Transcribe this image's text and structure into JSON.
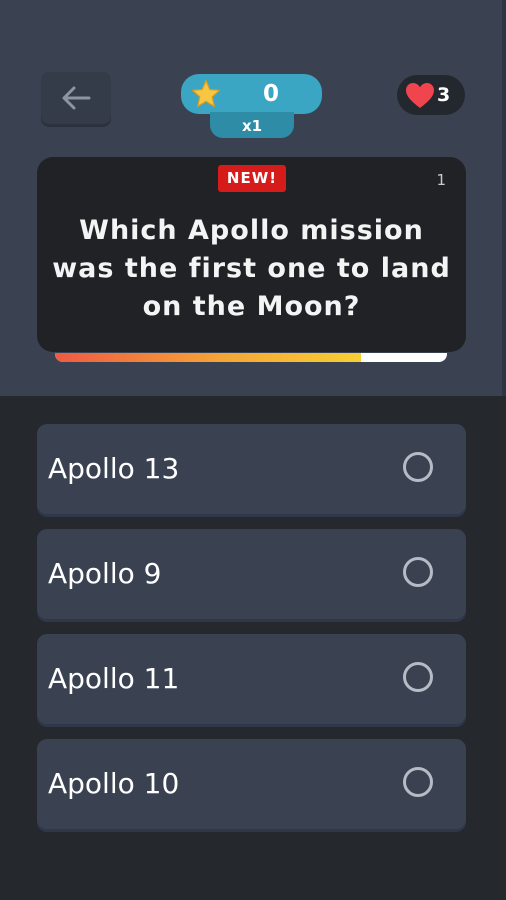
{
  "header": {
    "back_icon": "arrow-left-icon",
    "score": "0",
    "multiplier": "x1",
    "lives": "3",
    "star_icon": "star-icon",
    "heart_icon": "heart-icon"
  },
  "question": {
    "badge": "NEW!",
    "number": "1",
    "text": "Which Apollo mission was the first one to land on the Moon?",
    "timer_remaining": 0.78
  },
  "answers": [
    {
      "label": "Apollo 13"
    },
    {
      "label": "Apollo 9"
    },
    {
      "label": "Apollo 11"
    },
    {
      "label": "Apollo 10"
    }
  ],
  "colors": {
    "top_panel": "#3a4252",
    "background": "#25282d",
    "score_pill": "#3aa6c3",
    "new_badge": "#d61b1b",
    "heart": "#f0454f",
    "star": "#f7c743"
  }
}
